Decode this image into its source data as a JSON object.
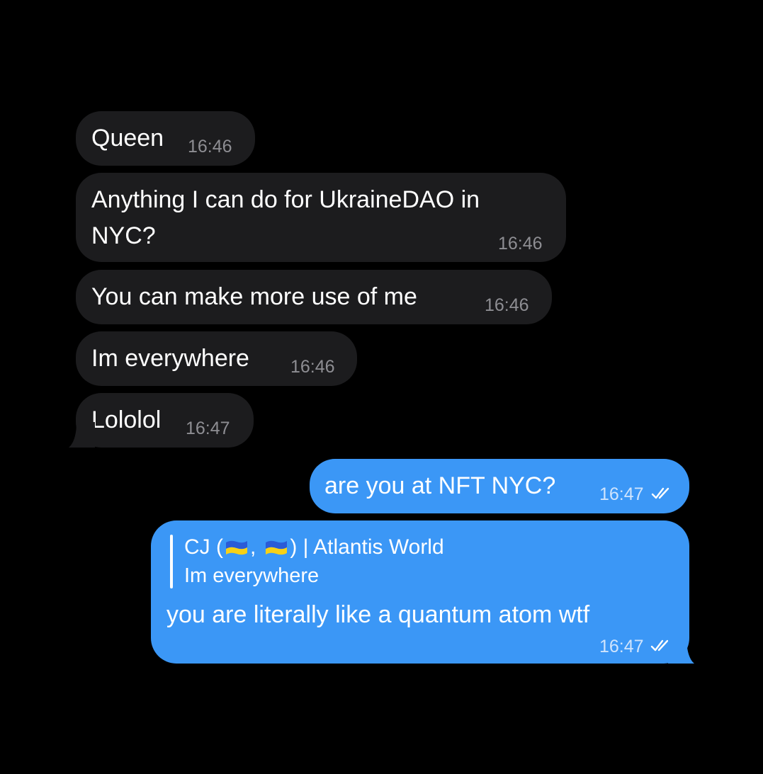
{
  "incoming": [
    {
      "text": "Queen",
      "time": "16:46"
    },
    {
      "text_line1": "Anything I can do for UkraineDAO in",
      "text_line2": "NYC?",
      "time": "16:46"
    },
    {
      "text": "You can make more use of me",
      "time": "16:46"
    },
    {
      "text": "Im everywhere",
      "time": "16:46"
    },
    {
      "text": "Lololol",
      "time": "16:47"
    }
  ],
  "outgoing": [
    {
      "text": "are you at NFT NYC?",
      "time": "16:47",
      "status_icon": "double-check-icon"
    },
    {
      "reply": {
        "name_prefix": "CJ (",
        "name_sep": ",",
        "name_suffix": ") | Atlantis World",
        "flag_icon": "ukraine-flag-icon",
        "quoted_text": "Im everywhere"
      },
      "text": "you are literally like a quantum atom wtf",
      "time": "16:47",
      "status_icon": "double-check-icon"
    }
  ],
  "colors": {
    "background": "#000000",
    "incoming_bubble": "#1c1c1e",
    "outgoing_bubble": "#3b97f6",
    "flag_blue": "#2a5bd7",
    "flag_yellow": "#f7d117"
  }
}
